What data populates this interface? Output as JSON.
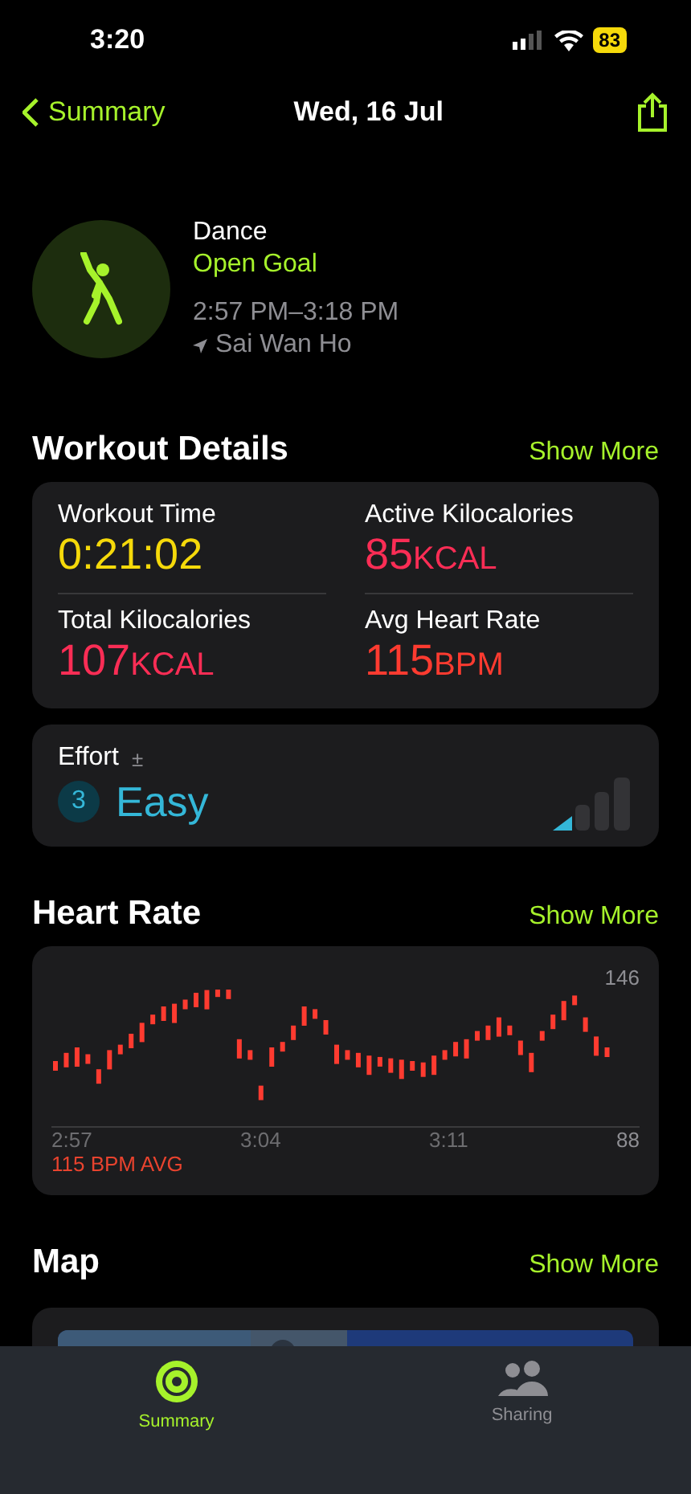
{
  "status_bar": {
    "time": "3:20",
    "battery": "83"
  },
  "nav": {
    "back": "Summary",
    "title": "Wed, 16 Jul"
  },
  "workout": {
    "name": "Dance",
    "goal": "Open Goal",
    "time_range": "2:57 PM–3:18 PM",
    "location": "Sai Wan Ho"
  },
  "details": {
    "title": "Workout Details",
    "action": "Show More",
    "metrics": [
      {
        "label": "Workout Time",
        "value": "0:21:02",
        "color": "#f5d90a"
      },
      {
        "label": "Active Kilocalories",
        "value": "85",
        "unit": "KCAL",
        "color": "#fa2d55"
      },
      {
        "label": "Total Kilocalories",
        "value": "107",
        "unit": "KCAL",
        "color": "#fa2d55"
      },
      {
        "label": "Avg Heart Rate",
        "value": "115",
        "unit": "BPM",
        "color": "#ff3b30"
      }
    ]
  },
  "effort": {
    "label": "Effort",
    "adjust": "±",
    "rating": "3",
    "word": "Easy"
  },
  "heart_rate": {
    "title": "Heart Rate",
    "action": "Show More",
    "max": "146",
    "min": "88",
    "times": [
      "2:57",
      "3:04",
      "3:11"
    ],
    "average": "115 BPM AVG"
  },
  "map": {
    "title": "Map",
    "action": "Show More"
  },
  "tabs": [
    {
      "label": "Summary",
      "selected": true
    },
    {
      "label": "Sharing",
      "selected": false
    }
  ]
}
